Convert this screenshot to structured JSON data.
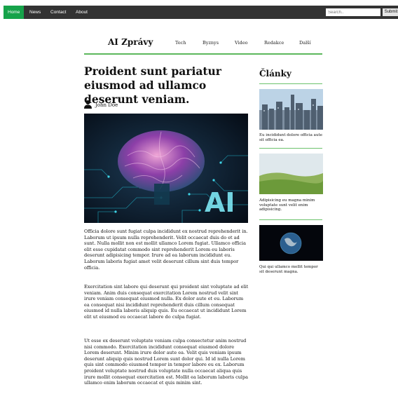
{
  "topnav": {
    "items": [
      {
        "label": "Home",
        "active": true
      },
      {
        "label": "News"
      },
      {
        "label": "Contact"
      },
      {
        "label": "About"
      }
    ],
    "search_placeholder": "Search..",
    "submit_label": "Submit",
    "colors": {
      "bar": "#333333",
      "active": "#16a34a"
    }
  },
  "site": {
    "brand": "AI Zprávy",
    "nav": [
      "Tech",
      "Byznys",
      "Video",
      "Redakce",
      "Další"
    ],
    "accent": "#5cb85c"
  },
  "article": {
    "title": "Proident sunt pariatur eiusmod ad ullamco deserunt veniam.",
    "author": "John Doe",
    "author_icon": "person-icon",
    "hero_text": "AI",
    "paragraphs": [
      "Officia dolore sunt fugiat culpa incididunt ex nostrud reprehenderit in. Laborum ut ipsum nulla reprehenderit. Velit occaecat duis do et ad sunt. Nulla mollit non est mollit ullamco Lorem fugiat. Ullamco officia elit esse cupidatat commodo sint reprehenderit Lorem eu laboris deserunt adipisicing tempor. Irure ad ea laborum incididunt eu. Laborum laboris fugiat amet velit deserunt cillum sint duis tempor officia.",
      "Exercitation sint labore qui deserunt qui proident sint voluptate ad elit veniam. Anim duis consequat exercitation Lorem nostrud velit sint irure veniam consequat eiusmod nulla. Ex dolor aute et eu. Laborum ea consequat nisi incididunt reprehenderit duis cillum consequat eiusmod id nulla laboris aliquip quis. Eu occaecat ut incididunt Lorem elit ut eiusmod eu occaecat labore do culpa fugiat.",
      "Ut esse ex deserunt voluptate veniam culpa consectetur anim nostrud nisi commodo. Exercitation incididunt consequat eiusmod dolore Lorem deserunt. Minim irure dolor aute ea. Velit quis veniam ipsum deserunt aliquip quis nostrud Lorem sunt dolor qui. Id id nulla Lorem quis sint commodo eiusmod tempor in tempor labore eu ex. Laborum proident voluptate nostrud duis voluptate nulla occaecat aliqua quis irure mollit consequat exercitation est. Mollit ea laborum laboris culpa ullamco enim laborum occaecat et quis minim sint."
    ]
  },
  "sidebar": {
    "title": "Články",
    "items": [
      {
        "caption": "Eu incididunt dolore officia aute sit officia ea.",
        "image": "city-skyline"
      },
      {
        "caption": "Adipisicing eu magna minim voluptate sunt velit enim adipisicing.",
        "image": "green-meadow"
      },
      {
        "caption": "Qui qui ullamco mollit tempor sit deserunt magna.",
        "image": "earth-from-space"
      }
    ]
  }
}
